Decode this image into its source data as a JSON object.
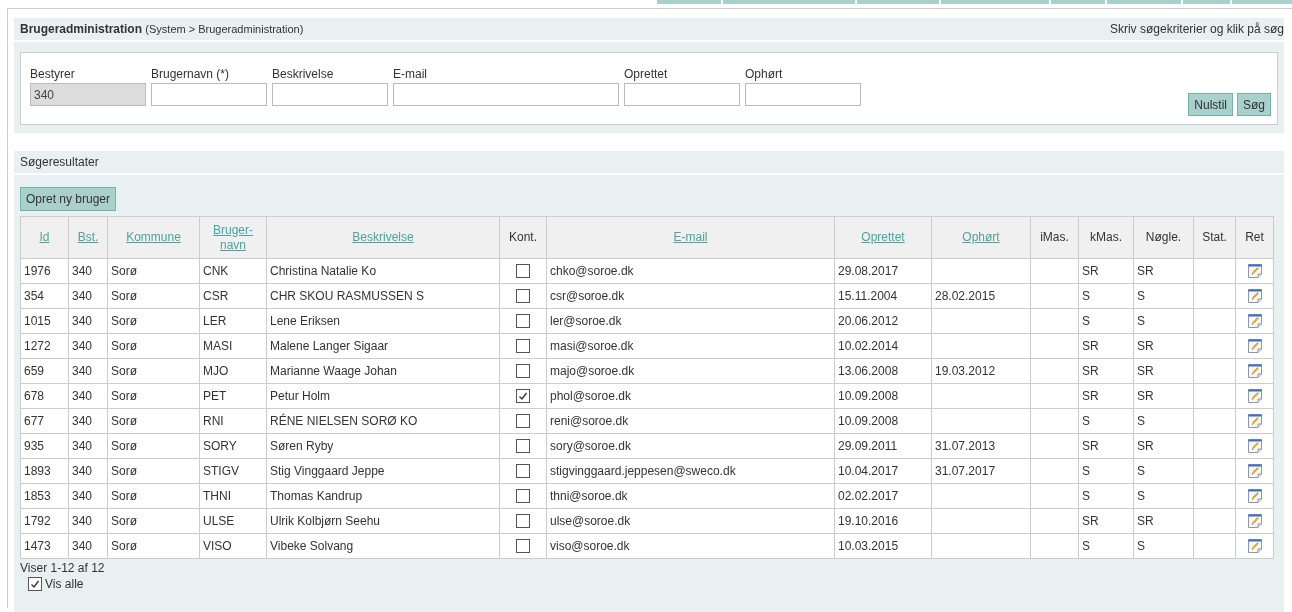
{
  "page_header": {
    "title": "Brugeradministration",
    "breadcrumb": "(System > Brugeradministration)",
    "hint": "Skriv søgekriterier og klik på søg"
  },
  "search_form": {
    "fields": [
      {
        "label": "Bestyrer",
        "value": "340",
        "disabled": true
      },
      {
        "label": "Brugernavn (*)",
        "disabled": false
      },
      {
        "label": "Beskrivelse",
        "disabled": false
      },
      {
        "label": "E-mail",
        "disabled": false
      },
      {
        "label": "Oprettet",
        "disabled": false
      },
      {
        "label": "Ophørt",
        "disabled": false
      }
    ],
    "buttons": [
      "Nulstil",
      "Søg"
    ]
  },
  "results": {
    "title": "Søgeresultater",
    "create_button": "Opret ny bruger",
    "columns": [
      {
        "label": "Id",
        "sortable": true
      },
      {
        "label": "Bst.",
        "sortable": true
      },
      {
        "label": "Kommune",
        "sortable": true
      },
      {
        "label": "Bruger-navn",
        "sortable": true
      },
      {
        "label": "Beskrivelse",
        "sortable": true
      },
      {
        "label": "Kont.",
        "sortable": false
      },
      {
        "label": "E-mail",
        "sortable": true
      },
      {
        "label": "Oprettet",
        "sortable": true
      },
      {
        "label": "Ophørt",
        "sortable": true
      },
      {
        "label": "iMas.",
        "sortable": false
      },
      {
        "label": "kMas.",
        "sortable": false
      },
      {
        "label": "Nøgle.",
        "sortable": false
      },
      {
        "label": "Stat.",
        "sortable": false
      },
      {
        "label": "Ret",
        "sortable": false
      }
    ],
    "rows": [
      {
        "id": "1976",
        "bst": "340",
        "kommune": "Sorø",
        "brugernavn": "CNK",
        "beskrivelse": "Christina Natalie Ko",
        "kont": false,
        "email": "chko@soroe.dk",
        "oprettet": "29.08.2017",
        "kmas": "SR",
        "noegle": "SR"
      },
      {
        "id": "354",
        "bst": "340",
        "kommune": "Sorø",
        "brugernavn": "CSR",
        "beskrivelse": "CHR SKOU RASMUSSEN S",
        "kont": false,
        "email": "csr@soroe.dk",
        "oprettet": "15.11.2004",
        "ophoert": "28.02.2015",
        "kmas": "S",
        "noegle": "S"
      },
      {
        "id": "1015",
        "bst": "340",
        "kommune": "Sorø",
        "brugernavn": "LER",
        "beskrivelse": "Lene Eriksen",
        "kont": false,
        "email": "ler@soroe.dk",
        "oprettet": "20.06.2012",
        "kmas": "S",
        "noegle": "S"
      },
      {
        "id": "1272",
        "bst": "340",
        "kommune": "Sorø",
        "brugernavn": "MASI",
        "beskrivelse": "Malene Langer Sigaar",
        "kont": false,
        "email": "masi@soroe.dk",
        "oprettet": "10.02.2014",
        "kmas": "SR",
        "noegle": "SR"
      },
      {
        "id": "659",
        "bst": "340",
        "kommune": "Sorø",
        "brugernavn": "MJO",
        "beskrivelse": "Marianne Waage Johan",
        "kont": false,
        "email": "majo@soroe.dk",
        "oprettet": "13.06.2008",
        "ophoert": "19.03.2012",
        "kmas": "SR",
        "noegle": "SR"
      },
      {
        "id": "678",
        "bst": "340",
        "kommune": "Sorø",
        "brugernavn": "PET",
        "beskrivelse": "Petur Holm",
        "kont": true,
        "email": "phol@soroe.dk",
        "oprettet": "10.09.2008",
        "kmas": "SR",
        "noegle": "SR"
      },
      {
        "id": "677",
        "bst": "340",
        "kommune": "Sorø",
        "brugernavn": "RNI",
        "beskrivelse": "RÉNE NIELSEN SORØ KO",
        "kont": false,
        "email": "reni@soroe.dk",
        "oprettet": "10.09.2008",
        "kmas": "S",
        "noegle": "S"
      },
      {
        "id": "935",
        "bst": "340",
        "kommune": "Sorø",
        "brugernavn": "SORY",
        "beskrivelse": "Søren Ryby",
        "kont": false,
        "email": "sory@soroe.dk",
        "oprettet": "29.09.2011",
        "ophoert": "31.07.2013",
        "kmas": "SR",
        "noegle": "SR"
      },
      {
        "id": "1893",
        "bst": "340",
        "kommune": "Sorø",
        "brugernavn": "STIGV",
        "beskrivelse": "Stig Vinggaard Jeppe",
        "kont": false,
        "email": "stigvinggaard.jeppesen@sweco.dk",
        "oprettet": "10.04.2017",
        "ophoert": "31.07.2017",
        "kmas": "S",
        "noegle": "S"
      },
      {
        "id": "1853",
        "bst": "340",
        "kommune": "Sorø",
        "brugernavn": "THNI",
        "beskrivelse": "Thomas Kandrup",
        "kont": false,
        "email": "thni@soroe.dk",
        "oprettet": "02.02.2017",
        "kmas": "S",
        "noegle": "S"
      },
      {
        "id": "1792",
        "bst": "340",
        "kommune": "Sorø",
        "brugernavn": "ULSE",
        "beskrivelse": "Ulrik Kolbjørn Seehu",
        "kont": false,
        "email": "ulse@soroe.dk",
        "oprettet": "19.10.2016",
        "kmas": "SR",
        "noegle": "SR"
      },
      {
        "id": "1473",
        "bst": "340",
        "kommune": "Sorø",
        "brugernavn": "VISO",
        "beskrivelse": "Vibeke Solvang",
        "kont": false,
        "email": "viso@soroe.dk",
        "oprettet": "10.03.2015",
        "kmas": "S",
        "noegle": "S"
      }
    ],
    "count": "Viser 1-12 af 12",
    "show_all": {
      "label": "Vis alle",
      "checked": true
    }
  }
}
